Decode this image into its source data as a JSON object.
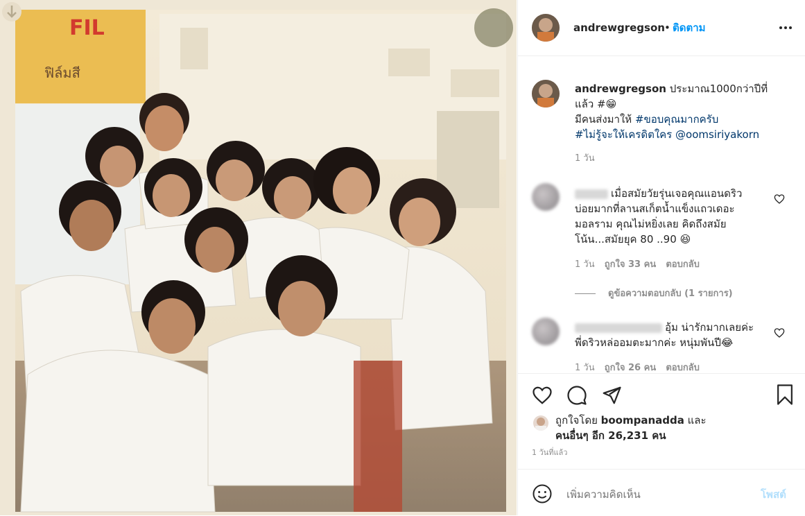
{
  "post": {
    "username": "andrewgregson",
    "follow_label": "ติดตาม",
    "dot": "•",
    "more_icon": "more-horizontal-icon"
  },
  "caption": {
    "line1": "ประมาณ1000กว่าปีที่",
    "line2_text": "แล้ว #",
    "line2_emoji": "😁",
    "line3_text": "มีคนส่งมาให้ ",
    "hashtag1": "#ขอบคุณมากครับ",
    "hashtag2": "#ไม่รู้จะให้เครดิตใคร",
    "mention": "@oomsiriyakorn",
    "time": "1 วัน"
  },
  "comments": [
    {
      "text_line1": "เมื่อสมัยวัยรุ่นเจอคุณแอนดริว",
      "text_line2": "บ่อยมากที่ลานสเก็ตน้ำแข็งแถวเดอะ",
      "text_line3": "มอลราม คุณไม่หยิ่งเลย คิดถึงสมัย",
      "text_line4": "โน้น...สมัยยุค 80 ..90",
      "emoji": "😆",
      "time": "1 วัน",
      "likes": "ถูกใจ 33 คน",
      "reply_label": "ตอบกลับ",
      "view_replies": "ดูข้อความตอบกลับ (1 รายการ)"
    },
    {
      "text_line1": "อุ้ม น่ารักมากเลยค่ะ",
      "text_line2": "พี่ดริวหล่ออมตะมากค่ะ หนุ่มพันปี",
      "emoji": "😂",
      "time": "1 วัน",
      "likes": "ถูกใจ 26 คน",
      "reply_label": "ตอบกลับ"
    }
  ],
  "likes": {
    "liked_by_prefix": "ถูกใจโดย ",
    "liked_by_user": "boompanadda",
    "liked_by_suffix": " และ",
    "others": "คนอื่นๆ อีก 26,231 คน"
  },
  "timestamp": "1 วันที่แล้ว",
  "comment_input": {
    "placeholder": "เพิ่มความคิดเห็น",
    "post_label": "โพสต์"
  },
  "photo_sign": {
    "line1": "FIL",
    "line2": "ฟิล์มสี"
  },
  "colors": {
    "accent_blue": "#0095f6",
    "link_blue": "#00376b",
    "muted": "#8e8e8e",
    "text": "#262626"
  }
}
